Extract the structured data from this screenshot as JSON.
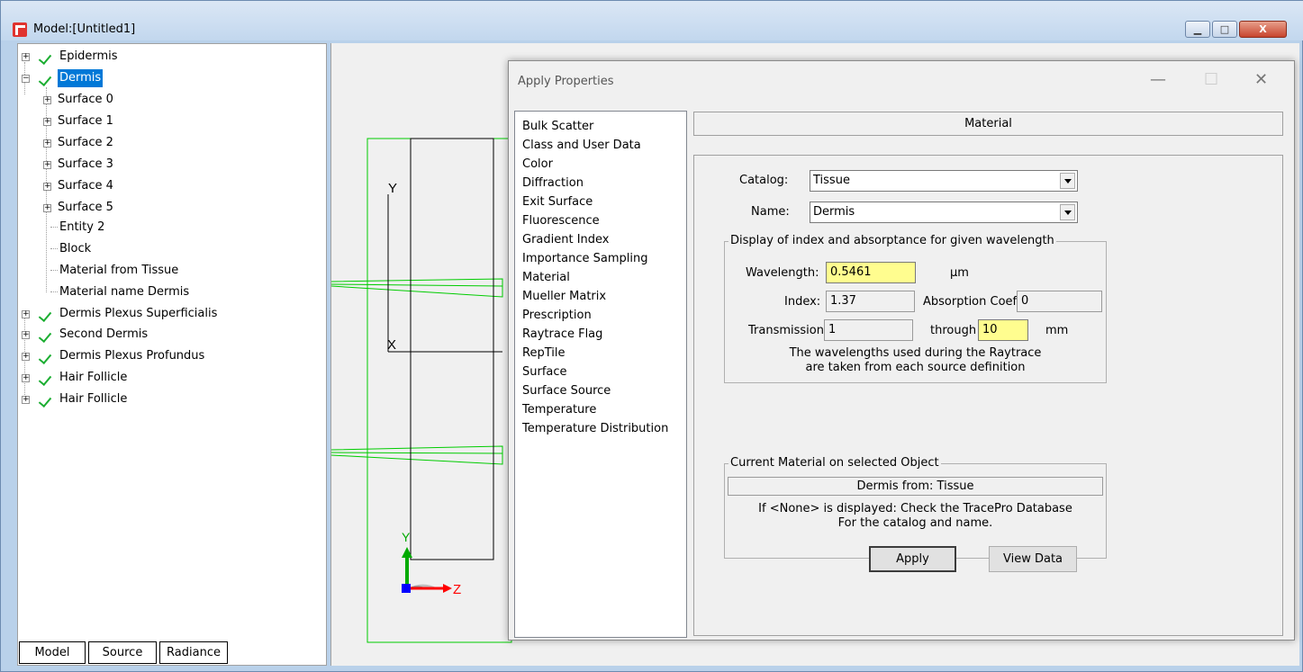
{
  "window": {
    "title": "Model:[Untitled1]",
    "controls": {
      "minimize": "▁",
      "maximize": "□",
      "close": "X"
    }
  },
  "tree": {
    "items": [
      {
        "label": "Epidermis"
      },
      {
        "label": "Dermis"
      },
      {
        "label": "Surface 0"
      },
      {
        "label": "Surface 1"
      },
      {
        "label": "Surface 2"
      },
      {
        "label": "Surface 3"
      },
      {
        "label": "Surface 4"
      },
      {
        "label": "Surface 5"
      },
      {
        "label": "Entity 2"
      },
      {
        "label": "Block"
      },
      {
        "label": "Material from Tissue"
      },
      {
        "label": "Material name Dermis"
      },
      {
        "label": "Dermis Plexus Superficialis"
      },
      {
        "label": "Second Dermis"
      },
      {
        "label": "Dermis Plexus Profundus"
      },
      {
        "label": "Hair Follicle"
      },
      {
        "label": "Hair Follicle"
      }
    ]
  },
  "bottom_tabs": [
    "Model",
    "Source",
    "Radiance"
  ],
  "viewport": {
    "axis_labels": {
      "y_top": "Y",
      "x_mid": "X",
      "triad_y": "Y",
      "triad_z": "Z"
    },
    "colors": {
      "wireframe": "#00cc00",
      "outline": "#000000",
      "triad_x": "#0000ff",
      "triad_y": "#00aa00",
      "triad_z": "#ff0000"
    }
  },
  "dialog": {
    "title": "Apply Properties",
    "controls": {
      "minimize": "—",
      "maximize": "☐",
      "close": "✕"
    },
    "property_list": [
      "Bulk Scatter",
      "Class and User Data",
      "Color",
      "Diffraction",
      "Exit Surface",
      "Fluorescence",
      "Gradient Index",
      "Importance Sampling",
      "Material",
      "Mueller Matrix",
      "Prescription",
      "Raytrace Flag",
      "RepTile",
      "Surface",
      "Surface Source",
      "Temperature",
      "Temperature Distribution"
    ],
    "panel_title": "Material",
    "catalog_label": "Catalog:",
    "catalog_value": "Tissue",
    "name_label": "Name:",
    "name_value": "Dermis",
    "display_group": {
      "title": "Display of index and absorptance for given wavelength",
      "wavelength_label": "Wavelength:",
      "wavelength_value": "0.5461",
      "wavelength_unit": "µm",
      "index_label": "Index:",
      "index_value": "1.37",
      "absorption_label": "Absorption Coef:",
      "absorption_value": "0",
      "transmission_label": "Transmission",
      "transmission_value": "1",
      "through_label": "through",
      "through_value": "10",
      "through_unit": "mm",
      "note_line1": "The wavelengths used during the Raytrace",
      "note_line2": "are taken from each source definition"
    },
    "current_group": {
      "title": "Current Material on selected Object",
      "value": "Dermis from: Tissue",
      "note_line1": "If <None> is displayed: Check the TracePro Database",
      "note_line2": "For the catalog and name."
    },
    "apply_button": "Apply",
    "view_data_button": "View Data"
  }
}
